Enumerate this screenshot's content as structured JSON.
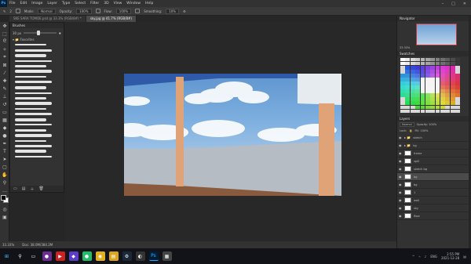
{
  "menubar": {
    "logo": "Ps",
    "items": [
      "File",
      "Edit",
      "Image",
      "Layer",
      "Type",
      "Select",
      "Filter",
      "3D",
      "View",
      "Window",
      "Help"
    ]
  },
  "options": {
    "mode_label": "Mode:",
    "mode_value": "Normal",
    "opacity_label": "Opacity:",
    "opacity_value": "100%",
    "flow_label": "Flow:",
    "flow_value": "100%",
    "smoothing_label": "Smoothing:",
    "smoothing_value": "10%",
    "brush_size": "2"
  },
  "tabs": [
    {
      "label": "SKE SARA TOMOE.psd @ 33.3% (RGB/8#) *",
      "active": false
    },
    {
      "label": "sky.jpg @ 41.7% (RGB/8#)",
      "active": true
    }
  ],
  "brushes_panel": {
    "title": "Brushes",
    "size_value": "30 px",
    "folder": "Favorites",
    "stroke_count": 22
  },
  "status": {
    "zoom": "33.33%",
    "doc": "Doc: 38.0M/384.2M"
  },
  "right_panels": {
    "navigator_title": "Navigator",
    "zoom": "33.33%",
    "swatches_title": "Swatches",
    "layers_title": "Layers",
    "blend_mode": "Normal",
    "opacity_label": "Opacity: 100%",
    "fill_label": "Fill: 100%",
    "lock_label": "Lock:"
  },
  "layers": [
    {
      "name": "sketch",
      "group": true,
      "selected": false
    },
    {
      "name": "bg",
      "group": true,
      "selected": false
    },
    {
      "name": "frame",
      "group": false,
      "selected": false
    },
    {
      "name": "spill",
      "group": false,
      "selected": false
    },
    {
      "name": "sketch bg",
      "group": false,
      "selected": false
    },
    {
      "name": "bg",
      "group": false,
      "selected": true
    },
    {
      "name": "bg",
      "group": false,
      "selected": false
    },
    {
      "name": "1",
      "group": false,
      "selected": false
    },
    {
      "name": "wall",
      "group": false,
      "selected": false
    },
    {
      "name": "sky",
      "group": false,
      "selected": false
    },
    {
      "name": "floor",
      "group": false,
      "selected": false
    }
  ],
  "taskbar": {
    "time": "2:55 PM",
    "date": "2021-12-28",
    "lang": "ENG"
  },
  "colors": {
    "foreground": "#000000",
    "background": "#ffffff",
    "accent": "#31a8ff"
  }
}
